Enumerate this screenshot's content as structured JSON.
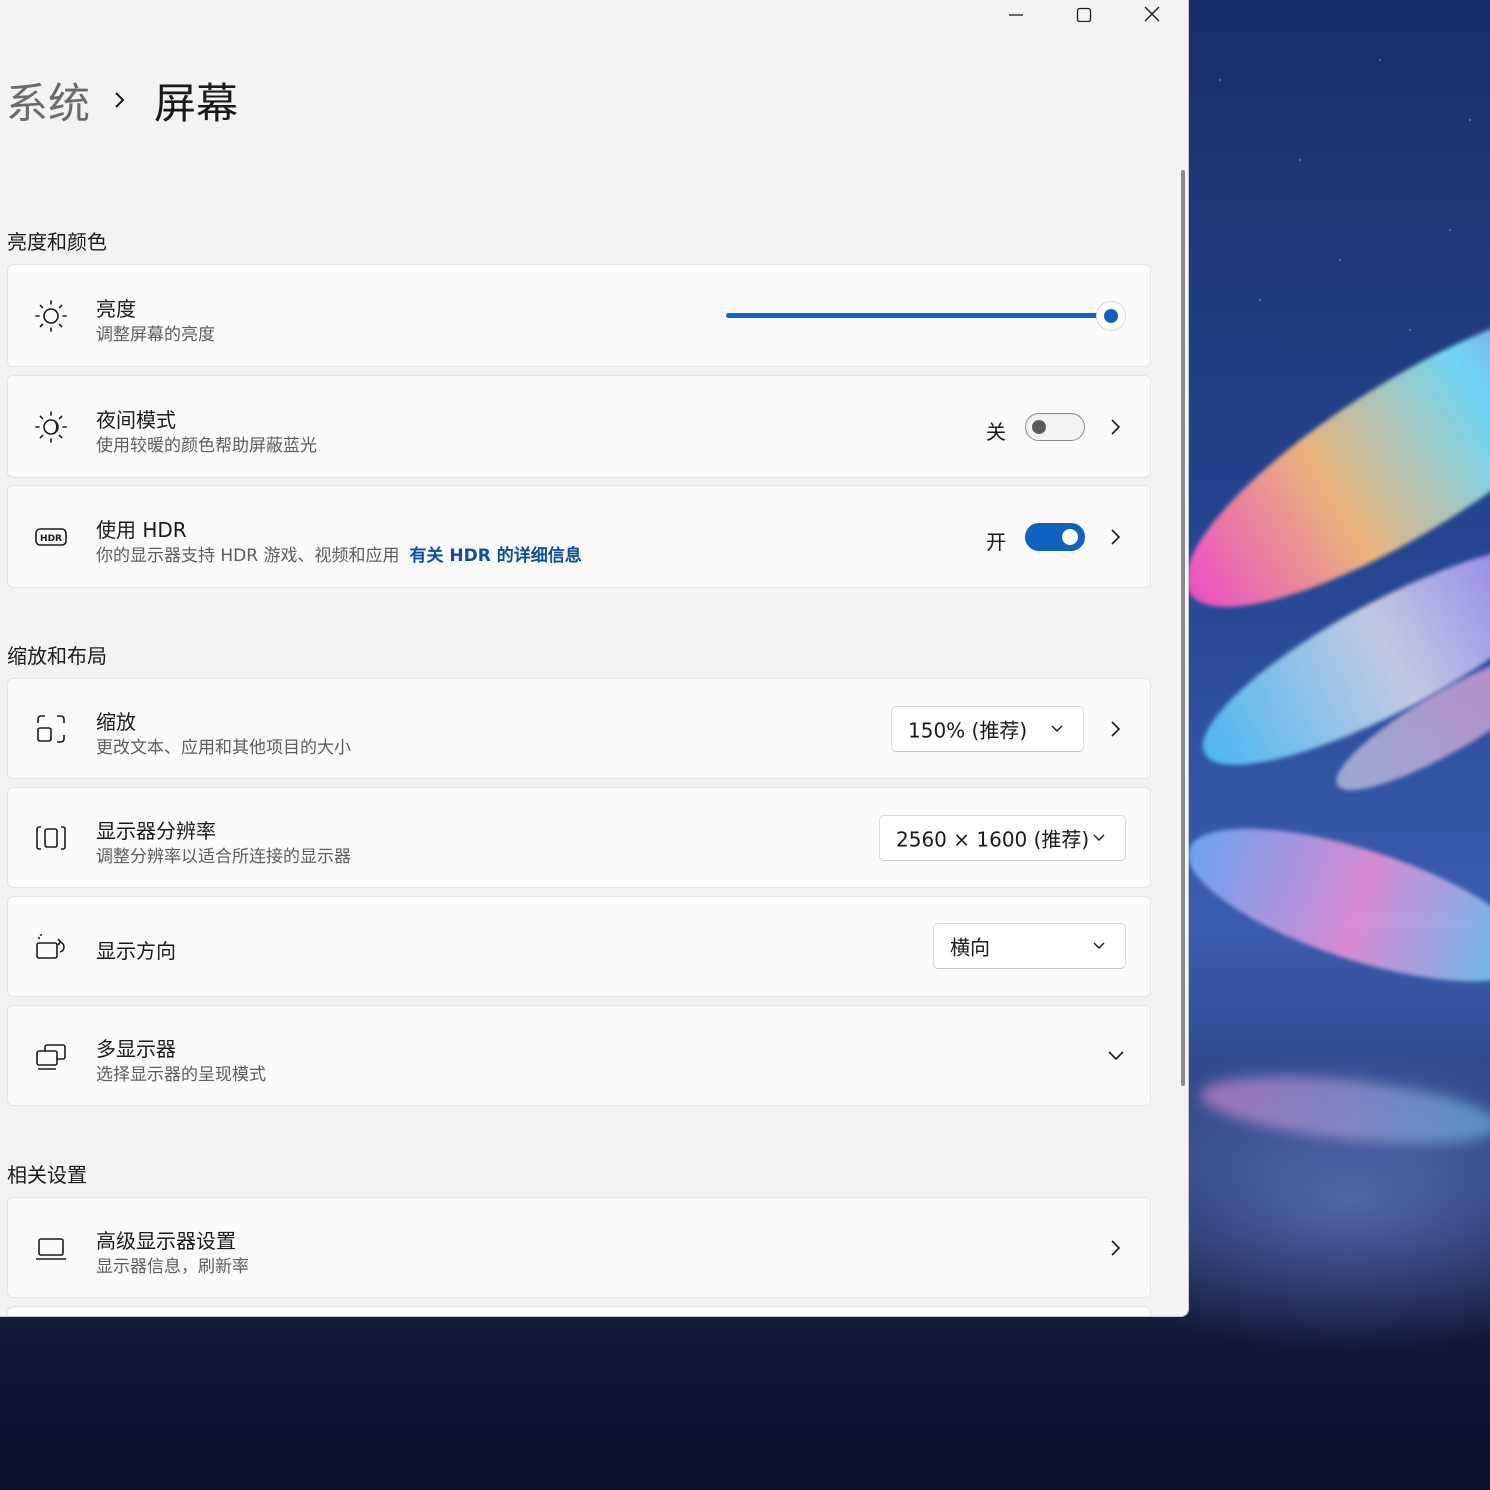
{
  "window": {
    "caption": {
      "minimize_icon": "minimize-icon",
      "maximize_icon": "maximize-icon",
      "close_icon": "close-icon"
    }
  },
  "breadcrumb": {
    "parent": "系统",
    "separator_icon": "chevron-right-icon",
    "current": "屏幕"
  },
  "sections": {
    "brightness_color": "亮度和颜色",
    "scale_layout": "缩放和布局",
    "related": "相关设置"
  },
  "brightness": {
    "title": "亮度",
    "subtitle": "调整屏幕的亮度",
    "value_percent": 100,
    "icon": "sun-icon"
  },
  "night_light": {
    "title": "夜间模式",
    "subtitle": "使用较暖的颜色帮助屏蔽蓝光",
    "state_label": "关",
    "state": false,
    "icon": "night-light-icon"
  },
  "hdr": {
    "title": "使用 HDR",
    "subtitle": "你的显示器支持 HDR 游戏、视频和应用",
    "link": "有关 HDR 的详细信息",
    "state_label": "开",
    "state": true,
    "icon": "hdr-icon"
  },
  "scale": {
    "title": "缩放",
    "subtitle": "更改文本、应用和其他项目的大小",
    "value": "150% (推荐)",
    "icon": "scale-icon"
  },
  "resolution": {
    "title": "显示器分辨率",
    "subtitle": "调整分辨率以适合所连接的显示器",
    "value": "2560 × 1600 (推荐)",
    "icon": "resolution-icon"
  },
  "orientation": {
    "title": "显示方向",
    "value": "横向",
    "icon": "orientation-icon"
  },
  "multi_display": {
    "title": "多显示器",
    "subtitle": "选择显示器的呈现模式",
    "icon": "multi-display-icon"
  },
  "advanced_display": {
    "title": "高级显示器设置",
    "subtitle": "显示器信息，刷新率",
    "icon": "laptop-icon"
  },
  "colors": {
    "accent": "#0f62be",
    "link": "#0d4ea0",
    "window_bg": "#f3f3f3",
    "card_bg": "#fbfbfb"
  }
}
